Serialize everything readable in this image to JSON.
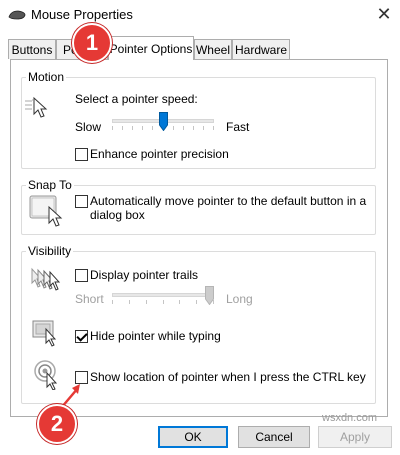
{
  "window": {
    "title": "Mouse Properties",
    "close_glyph": "✕"
  },
  "tabs": [
    {
      "label": "Buttons",
      "active": false
    },
    {
      "label": "Po",
      "active": false
    },
    {
      "label": "Pointer Options",
      "active": true
    },
    {
      "label": "Wheel",
      "active": false
    },
    {
      "label": "Hardware",
      "active": false
    }
  ],
  "motion": {
    "label": "Motion",
    "speed_label": "Select a pointer speed:",
    "slow_label": "Slow",
    "fast_label": "Fast",
    "speed_value": 0.5,
    "precision_label": "Enhance pointer precision",
    "precision_checked": false,
    "icon": "pointer-speed-icon"
  },
  "snap_to": {
    "label": "Snap To",
    "option_line1": "Automatically move pointer to the default button in a",
    "option_line2": "dialog box",
    "checked": false,
    "icon": "snap-to-button-icon"
  },
  "visibility": {
    "label": "Visibility",
    "trails_label": "Display pointer trails",
    "trails_checked": false,
    "short_label": "Short",
    "long_label": "Long",
    "trails_value": 1.0,
    "hide_label": "Hide pointer while typing",
    "hide_checked": true,
    "show_location_label": "Show location of pointer when I press the CTRL key",
    "show_location_checked": false
  },
  "buttons": {
    "ok": "OK",
    "cancel": "Cancel",
    "apply": "Apply"
  },
  "annotations": {
    "badge1": "1",
    "badge2": "2",
    "color": "#e53935"
  },
  "watermark": "wsxdn.com"
}
